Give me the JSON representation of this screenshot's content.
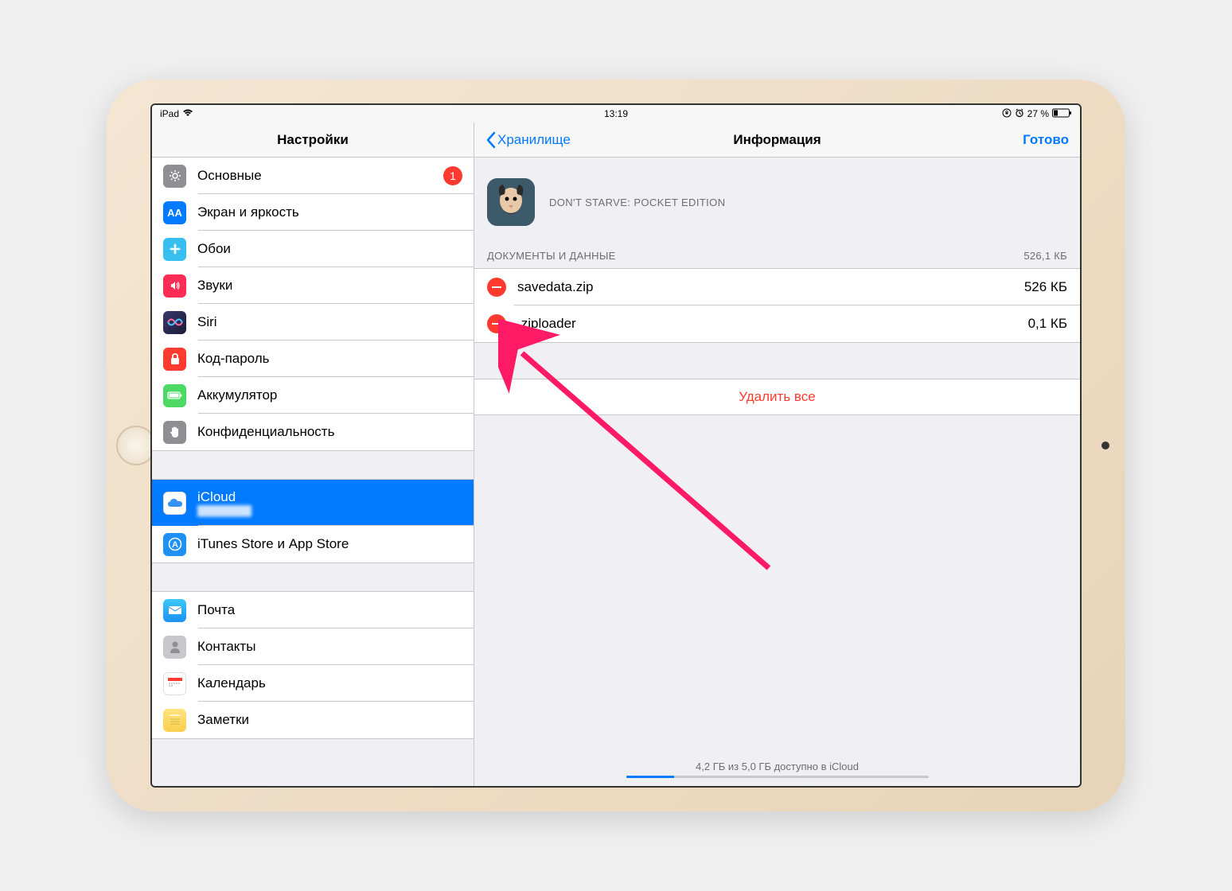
{
  "status_bar": {
    "device": "iPad",
    "time": "13:19",
    "battery_percent": "27 %"
  },
  "sidebar": {
    "title": "Настройки",
    "items": [
      {
        "label": "Основные",
        "badge": "1",
        "icon_bg": "#8e8e93",
        "icon": "gear"
      },
      {
        "label": "Экран и яркость",
        "icon_bg": "#007aff",
        "icon": "aa"
      },
      {
        "label": "Обои",
        "icon_bg": "#38bff2",
        "icon": "flower"
      },
      {
        "label": "Звуки",
        "icon_bg": "#ff2d55",
        "icon": "speaker"
      },
      {
        "label": "Siri",
        "icon_bg": "#000",
        "icon": "siri"
      },
      {
        "label": "Код-пароль",
        "icon_bg": "#ff3b30",
        "icon": "lock"
      },
      {
        "label": "Аккумулятор",
        "icon_bg": "#4cd964",
        "icon": "battery"
      },
      {
        "label": "Конфиденциальность",
        "icon_bg": "#8e8e93",
        "icon": "hand"
      }
    ],
    "group2": [
      {
        "label": "iCloud",
        "icon_bg": "#fff",
        "icon": "cloud",
        "subtext": "user"
      },
      {
        "label": "iTunes Store и App Store",
        "icon_bg": "#1d91f4",
        "icon": "appstore"
      }
    ],
    "group3": [
      {
        "label": "Почта",
        "icon_bg": "#1d91f4",
        "icon": "mail"
      },
      {
        "label": "Контакты",
        "icon_bg": "#8e8e93",
        "icon": "contact"
      },
      {
        "label": "Календарь",
        "icon_bg": "#fff",
        "icon": "calendar"
      },
      {
        "label": "Заметки",
        "icon_bg": "#fccf4d",
        "icon": "notes"
      }
    ]
  },
  "main": {
    "back_label": "Хранилище",
    "title": "Информация",
    "done_label": "Готово",
    "app_name": "DON'T STARVE: POCKET EDITION",
    "section_label": "ДОКУМЕНТЫ И ДАННЫЕ",
    "section_size": "526,1 КБ",
    "files": [
      {
        "name": "savedata.zip",
        "size": "526 КБ"
      },
      {
        "name": ".ziploader",
        "size": "0,1 КБ"
      }
    ],
    "delete_all": "Удалить все",
    "storage_text": "4,2 ГБ из 5,0 ГБ доступно в iCloud"
  }
}
